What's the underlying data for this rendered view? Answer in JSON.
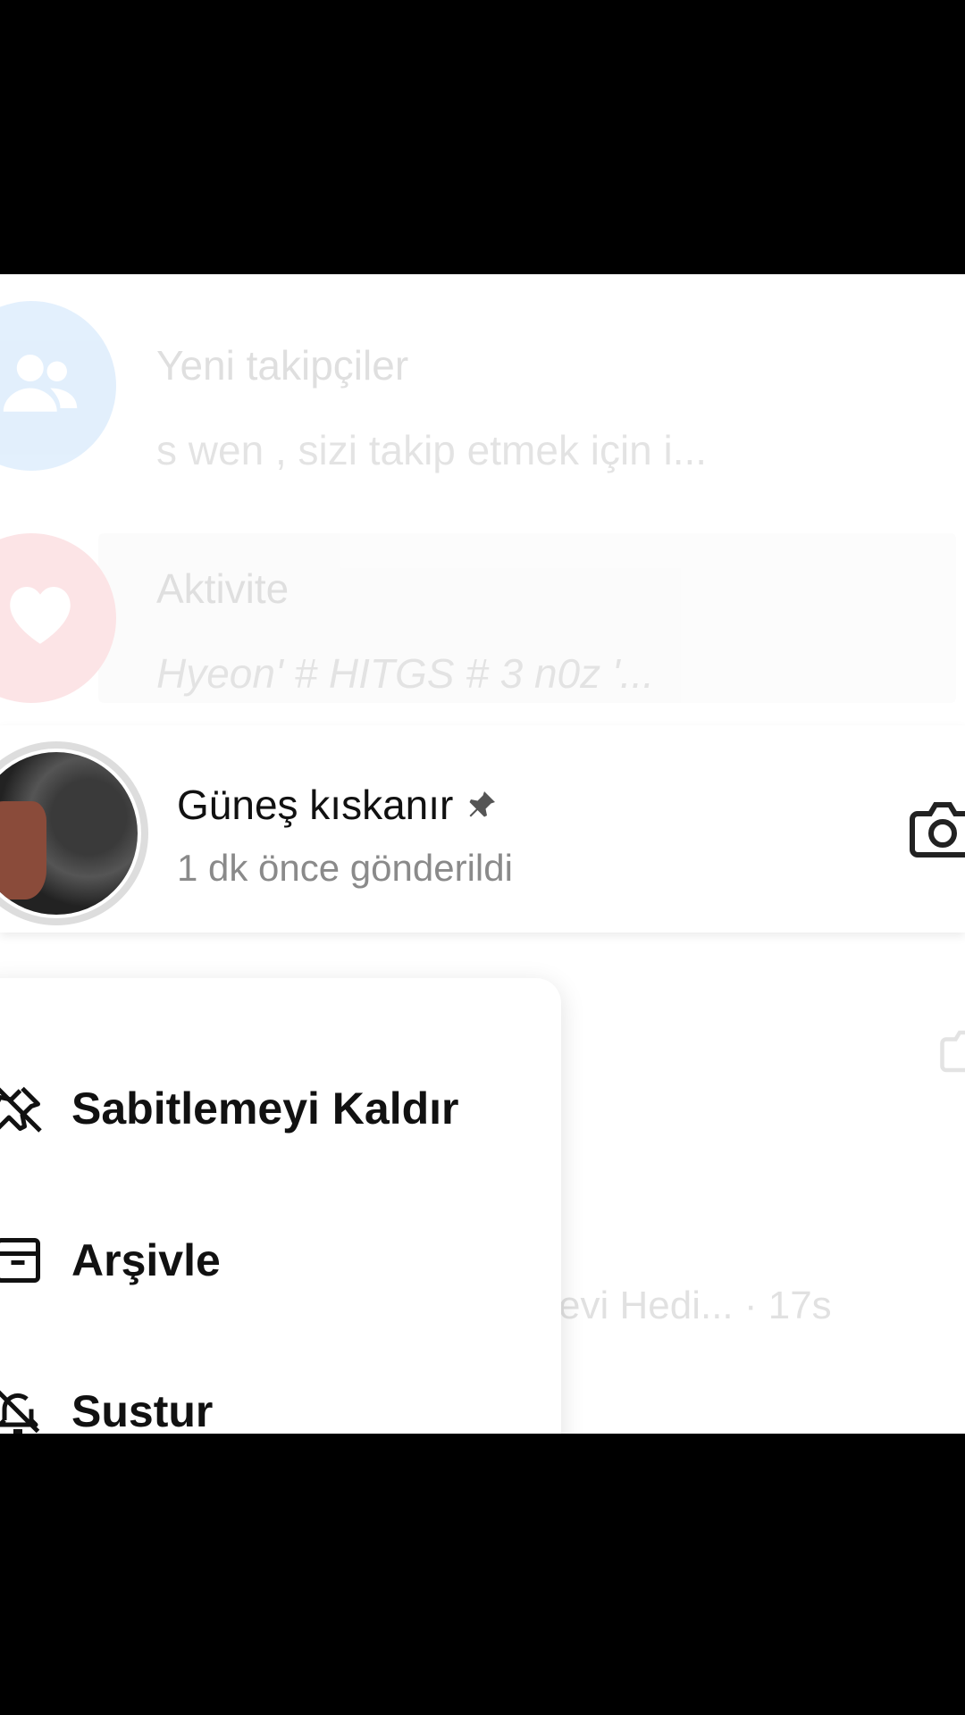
{
  "notifications": {
    "followers": {
      "title": "Yeni takipçiler",
      "subtitle": "s   wen  ,  sizi takip etmek için i..."
    },
    "activity": {
      "title": "Aktivite",
      "subtitle": "Hyeon'    # HITGS  #   3 n0z '..."
    }
  },
  "pinned_chat": {
    "name": "Güneş kıskanır",
    "status": "1 dk önce gönderildi"
  },
  "background_preview": "evi Hedi...  · 17s",
  "context_menu": {
    "items": [
      {
        "label": "Sabitlemeyi Kaldır",
        "icon": "unpin-icon"
      },
      {
        "label": "Arşivle",
        "icon": "archive-icon"
      },
      {
        "label": "Sustur",
        "icon": "mute-bell-icon"
      }
    ]
  },
  "colors": {
    "followers_accent": "#3897f0",
    "activity_accent": "#ed4956",
    "text_primary": "#111111",
    "text_secondary": "#8a8a8a"
  }
}
